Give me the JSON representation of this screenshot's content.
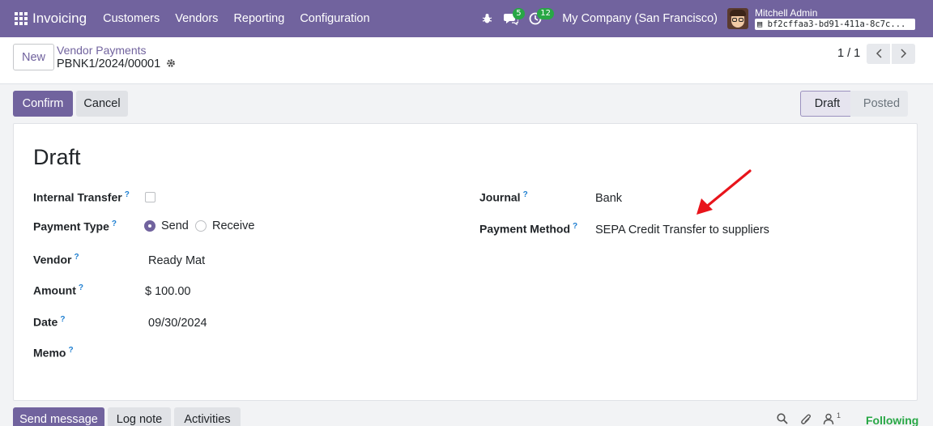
{
  "navbar": {
    "app_name": "Invoicing",
    "menu": [
      "Customers",
      "Vendors",
      "Reporting",
      "Configuration"
    ],
    "messages_count": "5",
    "activities_count": "12",
    "company": "My Company (San Francisco)",
    "user_name": "Mitchell Admin",
    "database": "bf2cffaa3-bd91-411a-8c7c..."
  },
  "control": {
    "new_label": "New",
    "breadcrumb_parent": "Vendor Payments",
    "breadcrumb_current": "PBNK1/2024/00001",
    "pager": "1 / 1"
  },
  "actions": {
    "confirm_label": "Confirm",
    "cancel_label": "Cancel"
  },
  "statusbar": {
    "stages": [
      "Draft",
      "Posted"
    ],
    "active_stage": "Draft"
  },
  "form": {
    "title": "Draft",
    "internal_transfer_label": "Internal Transfer",
    "internal_transfer_value": false,
    "payment_type_label": "Payment Type",
    "payment_type_options": [
      "Send",
      "Receive"
    ],
    "payment_type_selected": "Send",
    "vendor_label": "Vendor",
    "vendor_value": "Ready Mat",
    "amount_label": "Amount",
    "amount_value": "$ 100.00",
    "date_label": "Date",
    "date_value": "09/30/2024",
    "memo_label": "Memo",
    "memo_value": "",
    "journal_label": "Journal",
    "journal_value": "Bank",
    "payment_method_label": "Payment Method",
    "payment_method_value": "SEPA Credit Transfer to suppliers",
    "help_marker": "?"
  },
  "chatter": {
    "send_message_label": "Send message",
    "log_note_label": "Log note",
    "activities_label": "Activities",
    "followers_count": "1",
    "following_label": "Following"
  },
  "colors": {
    "brand": "#71639e",
    "success": "#28a745",
    "annotation_arrow": "#e8141b"
  }
}
